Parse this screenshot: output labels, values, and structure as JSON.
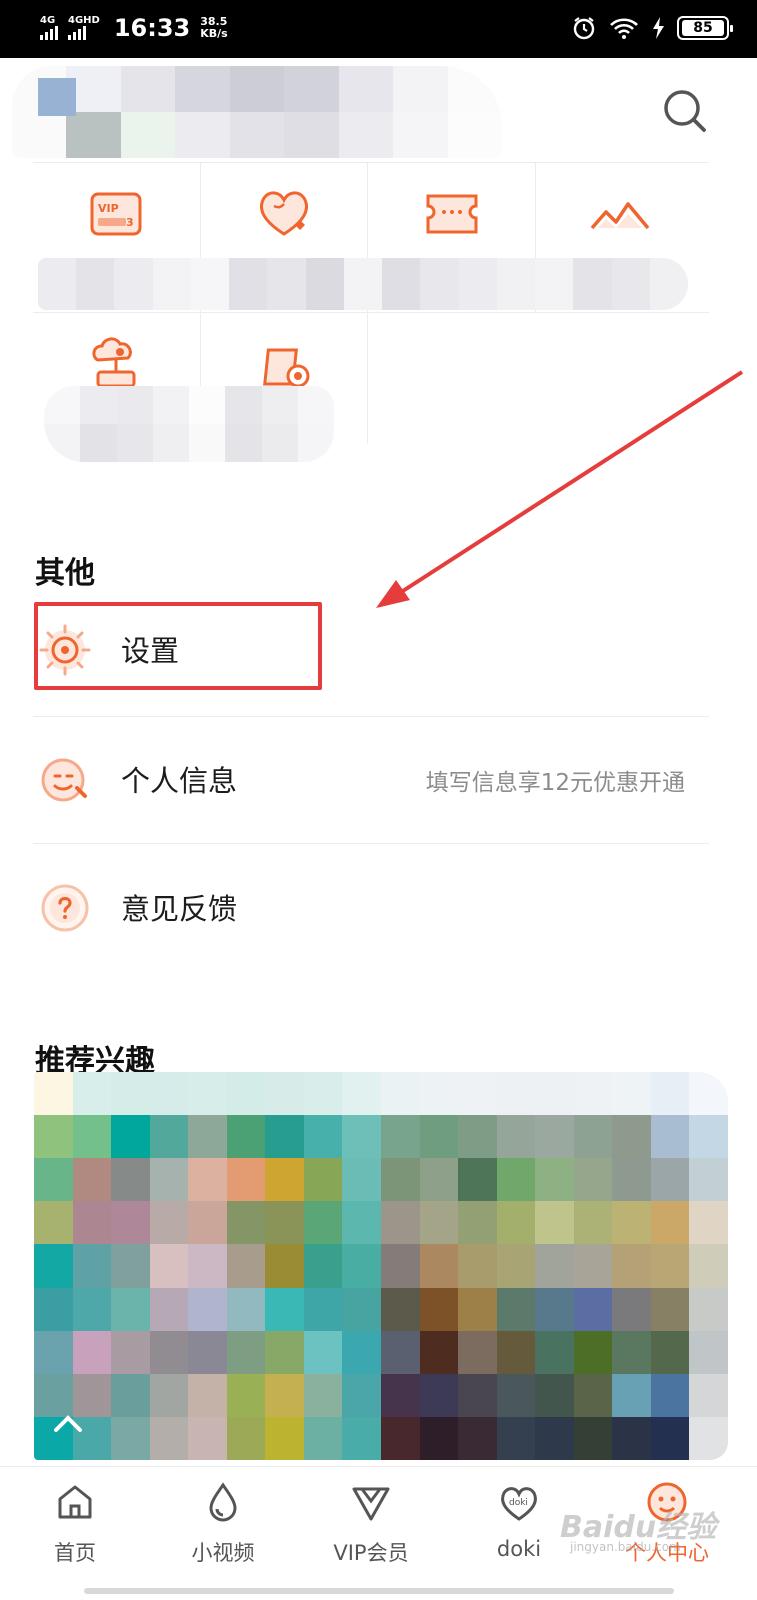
{
  "status_bar": {
    "signal1_label": "4G",
    "signal2_label": "4GHD",
    "time": "16:33",
    "speed_value": "38.5",
    "speed_unit": "KB/s",
    "battery": "85"
  },
  "other_section": {
    "title": "其他",
    "items": [
      {
        "label": "设置",
        "icon": "settings-gear-icon"
      },
      {
        "label": "个人信息",
        "hint": "填写信息享12元优惠开通",
        "icon": "face-edit-icon"
      },
      {
        "label": "意见反馈",
        "icon": "question-icon"
      }
    ]
  },
  "interest_section": {
    "title": "推荐兴趣"
  },
  "services": [
    {
      "icon": "vip-coupon-icon"
    },
    {
      "icon": "heart-points-icon"
    },
    {
      "icon": "ticket-icon"
    },
    {
      "icon": "mountain-icon"
    },
    {
      "icon": "gift-tree-icon"
    },
    {
      "icon": "cup-record-icon"
    }
  ],
  "bottom_nav": [
    {
      "label": "首页",
      "icon": "home-icon",
      "active": false
    },
    {
      "label": "小视频",
      "icon": "droplet-icon",
      "active": false
    },
    {
      "label": "VIP会员",
      "icon": "vip-diamond-icon",
      "active": false
    },
    {
      "label": "doki",
      "icon": "doki-heart-icon",
      "active": false
    },
    {
      "label": "个人中心",
      "icon": "profile-face-icon",
      "active": true
    }
  ],
  "watermark": {
    "text": "Baidu经验",
    "sub": "jingyan.baidu.com"
  },
  "colors": {
    "accent": "#f0642e",
    "annotation": "#e63c3c",
    "hint_text": "#8c8c8c"
  }
}
